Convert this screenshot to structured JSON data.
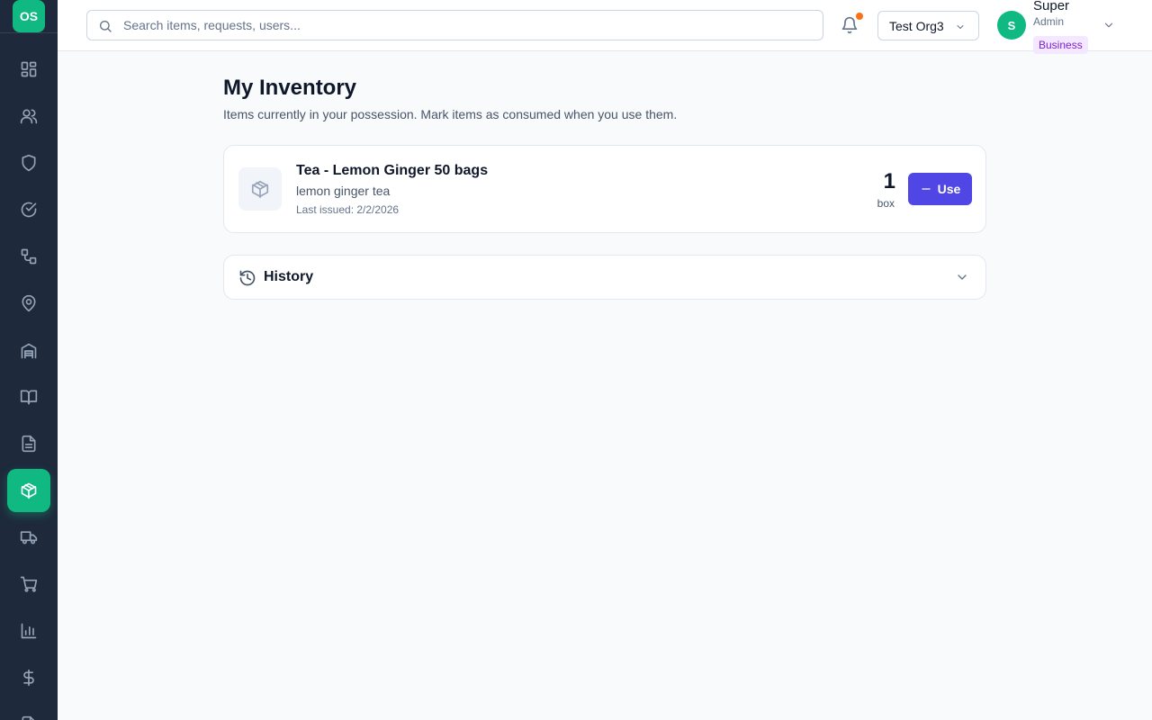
{
  "app": {
    "logo_text": "OS"
  },
  "sidebar": {
    "items": [
      {
        "icon": "dashboard-icon",
        "active": false
      },
      {
        "icon": "users-icon",
        "active": false
      },
      {
        "icon": "shield-icon",
        "active": false
      },
      {
        "icon": "check-circle-icon",
        "active": false
      },
      {
        "icon": "workflow-icon",
        "active": false
      },
      {
        "icon": "map-pin-icon",
        "active": false
      },
      {
        "icon": "warehouse-icon",
        "active": false
      },
      {
        "icon": "book-open-icon",
        "active": false
      },
      {
        "icon": "file-text-icon",
        "active": false
      },
      {
        "icon": "package-icon",
        "active": true
      },
      {
        "icon": "truck-icon",
        "active": false
      },
      {
        "icon": "shopping-cart-icon",
        "active": false
      },
      {
        "icon": "bar-chart-icon",
        "active": false
      },
      {
        "icon": "dollar-sign-icon",
        "active": false
      },
      {
        "icon": "file-icon",
        "active": false
      }
    ]
  },
  "header": {
    "search": {
      "placeholder": "Search items, requests, users..."
    },
    "notifications": {
      "has_unread": true
    },
    "org_selector": {
      "selected": "Test Org3"
    },
    "user": {
      "initial": "S",
      "name": "Super",
      "role": "Admin",
      "plan": "Business"
    }
  },
  "main": {
    "title": "My Inventory",
    "subtitle": "Items currently in your possession. Mark items as consumed when you use them.",
    "items": [
      {
        "name": "Tea - Lemon Ginger 50 bags",
        "description": "lemon ginger tea",
        "last_issued": "Last issued: 2/2/2026",
        "quantity": "1",
        "unit": "box",
        "action_label": "Use"
      }
    ],
    "history": {
      "label": "History",
      "expanded": false
    }
  },
  "colors": {
    "accent": "#10b981",
    "primary_button": "#4f46e5",
    "sidebar_bg": "#1e293b",
    "notification_dot": "#f97316",
    "plan_badge_bg": "#f3e8ff",
    "plan_badge_text": "#7e22ce"
  }
}
